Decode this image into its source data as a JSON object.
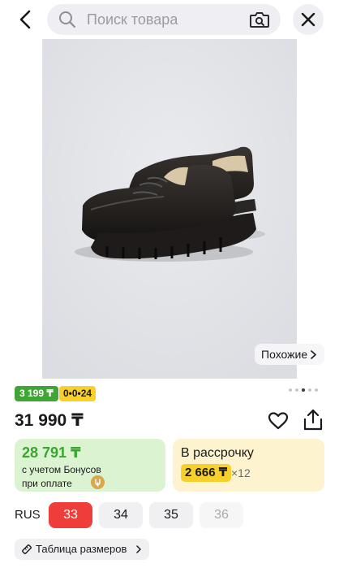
{
  "header": {
    "search_placeholder": "Поиск товара"
  },
  "product": {
    "similar_label": "Похожие",
    "badge_price": "3 199 ₸",
    "badge_timer": "0•0•24",
    "price": "31 990 ₸"
  },
  "bonus": {
    "amount": "28 791 ₸",
    "line1": "с учетом Бонусов",
    "line2": "при оплате"
  },
  "installment": {
    "title": "В рассрочку",
    "amount": "2 666 ₸",
    "times": "×12"
  },
  "sizes": {
    "label": "RUS",
    "options": [
      "33",
      "34",
      "35",
      "36"
    ],
    "selected": "33",
    "unavailable": [
      "36"
    ]
  },
  "size_table": {
    "label": "Таблица размеров"
  },
  "gallery": {
    "image_count_dots": 5,
    "active_dot": 3
  },
  "colors": {
    "accent_red": "#ef3e3a",
    "bonus_green": "#3fa535",
    "promo_yellow": "#f7d02b"
  },
  "icons": [
    "back-arrow-icon",
    "search-icon",
    "camera-search-icon",
    "close-icon",
    "chevron-right-icon",
    "heart-icon",
    "share-icon",
    "coin-icon",
    "ruler-icon"
  ]
}
